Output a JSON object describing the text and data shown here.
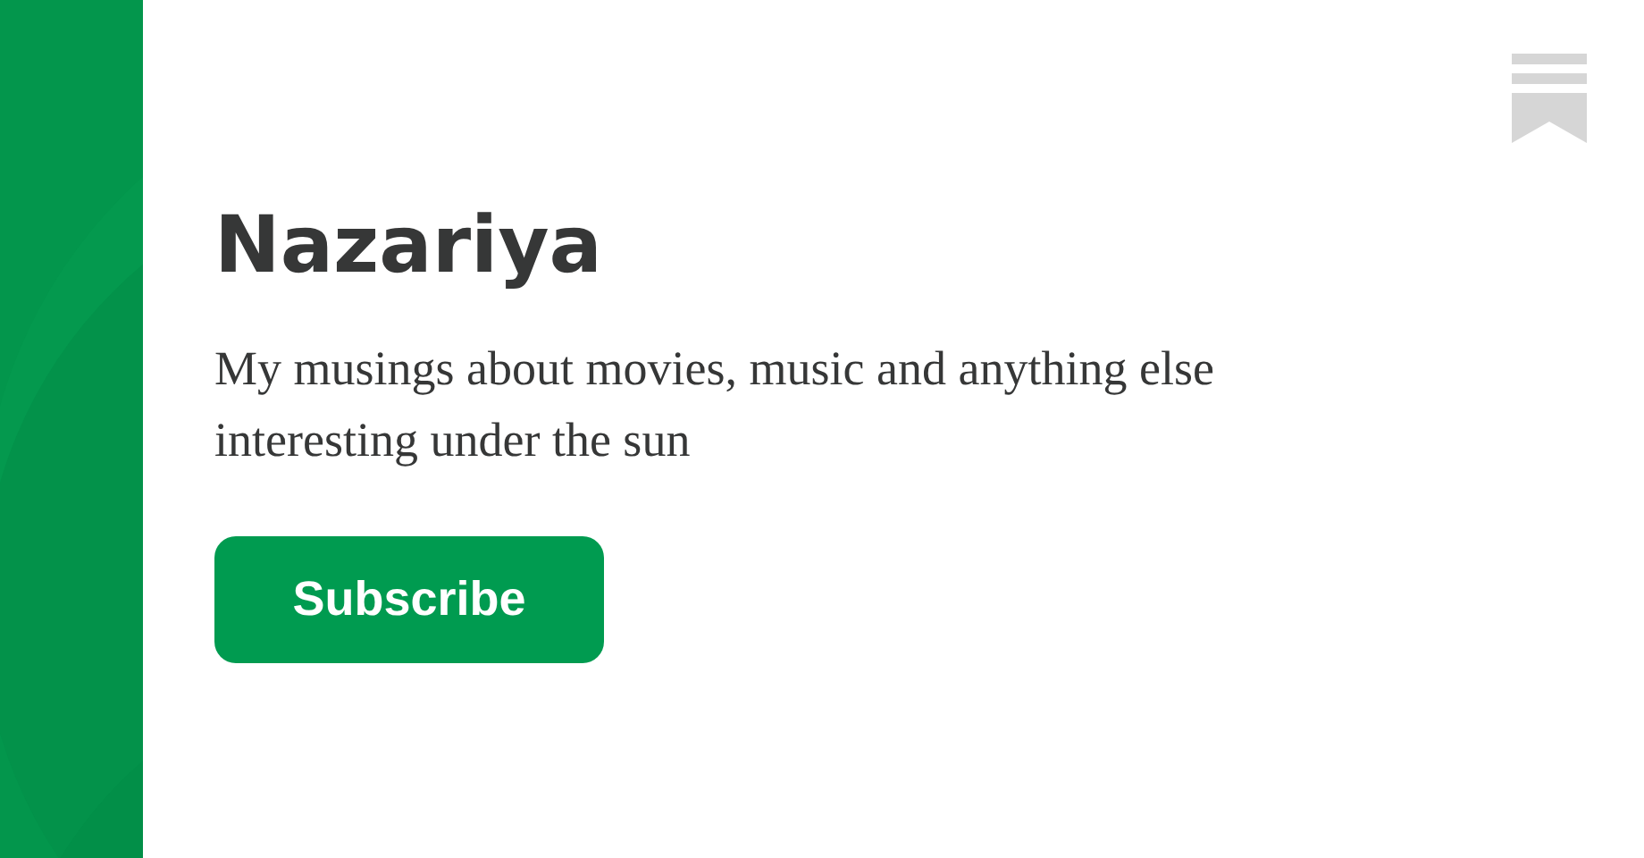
{
  "publication": {
    "title": "Nazariya",
    "description": "My musings about movies, music and anything else interesting under the sun"
  },
  "subscribe_button": {
    "label": "Subscribe"
  }
}
